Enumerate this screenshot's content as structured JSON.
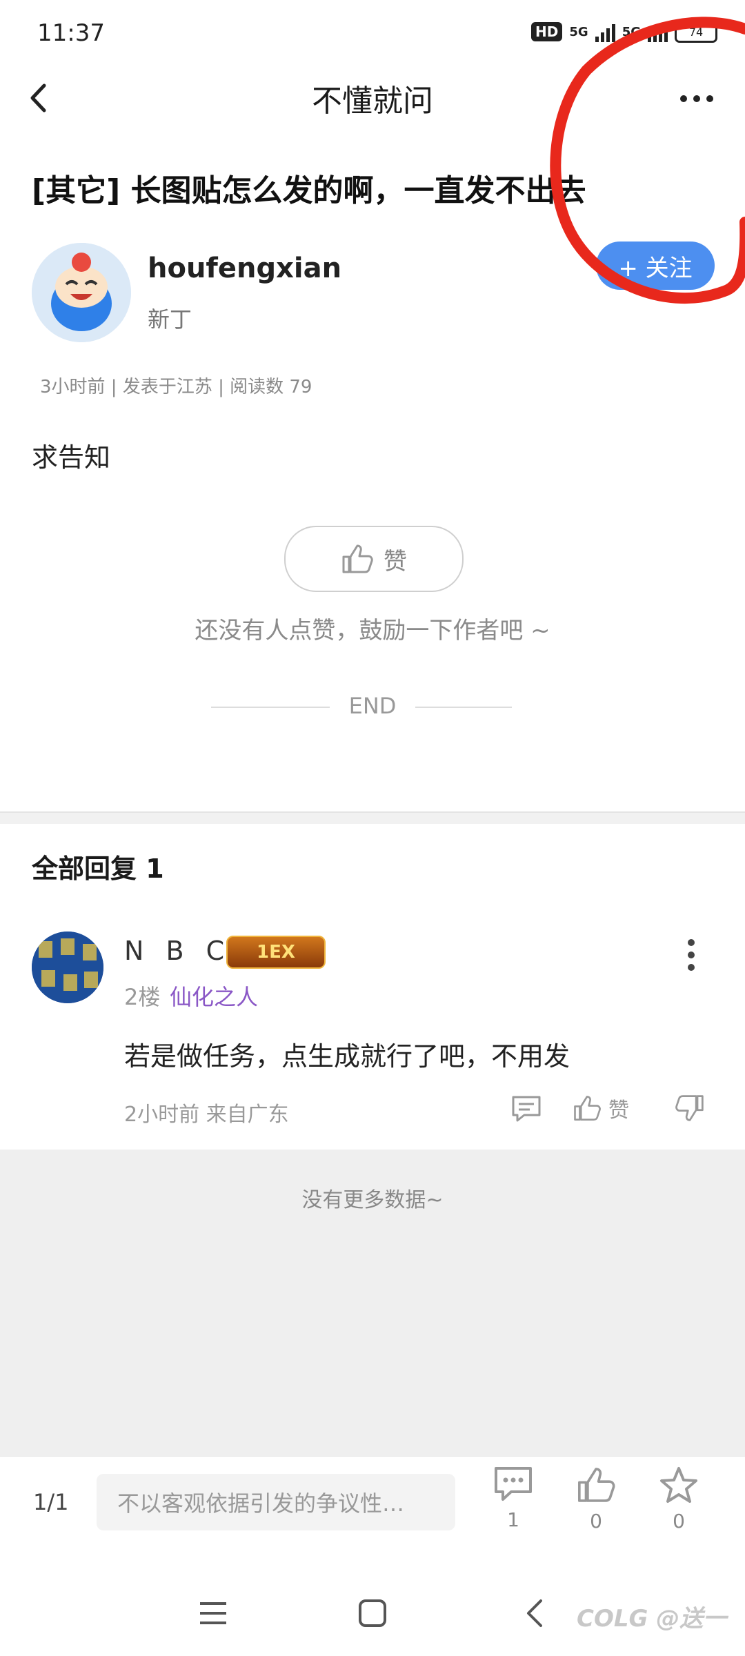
{
  "status_bar": {
    "time": "11:37",
    "hd_label": "HD",
    "net1": "5G",
    "net2": "5G",
    "battery": "74"
  },
  "header": {
    "title": "不懂就问"
  },
  "post": {
    "title": "[其它] 长图贴怎么发的啊，一直发不出去",
    "author_name": "houfengxian",
    "author_rank": "新丁",
    "follow_label": "+ 关注",
    "meta": "3小时前 | 发表于江苏 | 阅读数 79",
    "body": "求告知",
    "like_label": "赞",
    "like_hint": "还没有人点赞，鼓励一下作者吧 ~",
    "end_label": "END"
  },
  "replies": {
    "header": "全部回复  1",
    "items": [
      {
        "name": "N B C S",
        "badge": "1EX",
        "floor": "2楼",
        "title": "仙化之人",
        "body": "若是做任务，点生成就行了吧，不用发",
        "time": "2小时前  来自广东",
        "like_label": "赞"
      }
    ],
    "no_more": "没有更多数据~"
  },
  "bottom_bar": {
    "page_indicator": "1/1",
    "input_placeholder": "不以客观依据引发的争议性…",
    "comment_count": "1",
    "like_count": "0",
    "fav_count": "0"
  },
  "watermark": "COLG @送一",
  "colors": {
    "accent": "#4d8ff0",
    "annotation": "#e8281c",
    "title_purple": "#8a57c6"
  }
}
